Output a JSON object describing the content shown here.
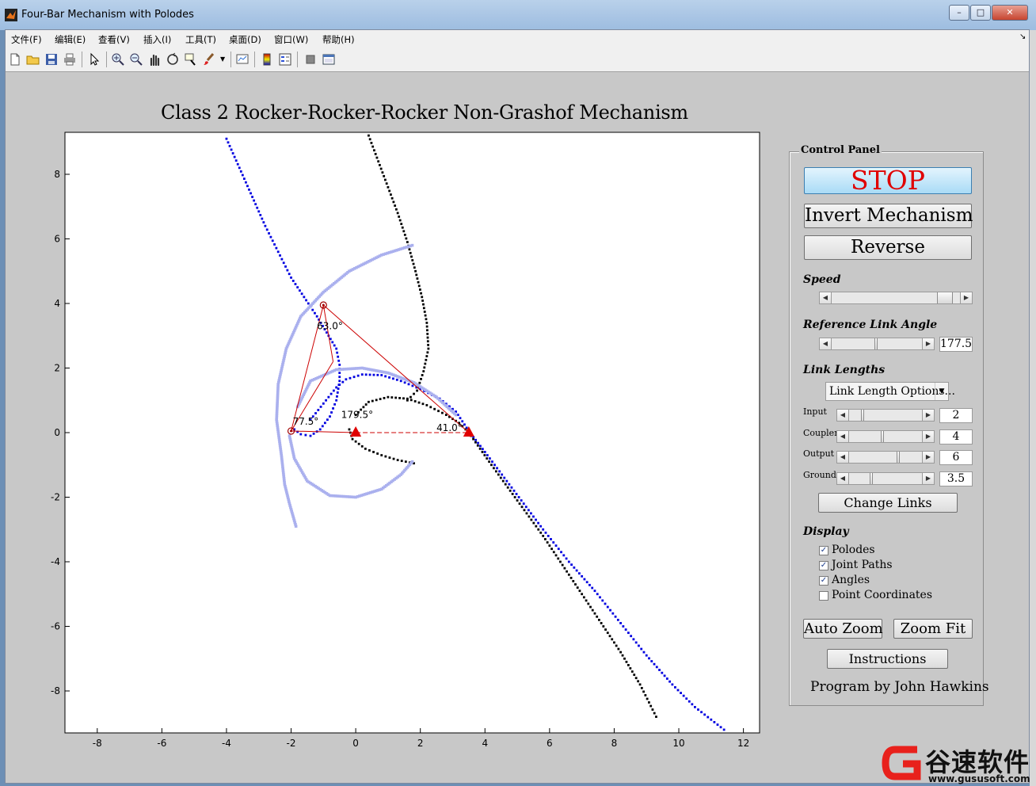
{
  "window": {
    "title": "Four-Bar Mechanism with Polodes",
    "controls": {
      "minimize": "–",
      "maximize": "□",
      "close": "✕"
    }
  },
  "menubar": {
    "items": [
      "文件(F)",
      "编辑(E)",
      "查看(V)",
      "插入(I)",
      "工具(T)",
      "桌面(D)",
      "窗口(W)",
      "帮助(H)"
    ],
    "dock_arrow": "↘"
  },
  "toolbar": {
    "icons": [
      "new-figure-icon",
      "open-file-icon",
      "save-icon",
      "print-icon",
      "pointer-icon",
      "zoom-in-icon",
      "zoom-out-icon",
      "pan-icon",
      "rotate-3d-icon",
      "data-cursor-icon",
      "brush-icon",
      "brush-dropdown-icon",
      "link-plot-icon",
      "colorbar-icon",
      "legend-icon",
      "hide-plot-tools-icon",
      "show-plot-tools-icon"
    ]
  },
  "plot": {
    "title": "Class 2 Rocker-Rocker-Rocker Non-Grashof Mechanism",
    "angle_labels": [
      "63.0°",
      "77.5°",
      "179.5°",
      "41.0°"
    ]
  },
  "chart_data": {
    "type": "scatter",
    "title": "Class 2 Rocker-Rocker-Rocker Non-Grashof Mechanism",
    "xlim": [
      -9,
      12.5
    ],
    "ylim": [
      -9.3,
      9.3
    ],
    "xticks": [
      -8,
      -6,
      -4,
      -2,
      0,
      2,
      4,
      6,
      8,
      10,
      12
    ],
    "yticks": [
      -8,
      -6,
      -4,
      -2,
      0,
      2,
      4,
      6,
      8
    ],
    "grid": false,
    "mechanism": {
      "joints": [
        [
          -2.0,
          0.05
        ],
        [
          -1.0,
          3.95
        ],
        [
          3.5,
          0.0
        ],
        [
          0.0,
          0.0
        ]
      ],
      "fixed_pivots": [
        [
          0.0,
          0.0
        ],
        [
          3.5,
          0.0
        ]
      ],
      "links_color": "#cc0000",
      "pivot_color": "#e00000"
    },
    "series": [
      {
        "color": "#0000e0",
        "points": [
          [
            -4.0,
            9.1
          ],
          [
            -3.6,
            8.2
          ],
          [
            -3.2,
            7.3
          ],
          [
            -2.8,
            6.4
          ],
          [
            -2.4,
            5.6
          ],
          [
            -2.0,
            4.8
          ],
          [
            -1.6,
            4.2
          ],
          [
            -1.2,
            3.6
          ],
          [
            -0.9,
            3.1
          ],
          [
            -0.6,
            2.6
          ],
          [
            -0.5,
            2.1
          ],
          [
            -0.5,
            1.6
          ],
          [
            -0.6,
            1.0
          ],
          [
            -0.8,
            0.5
          ],
          [
            -1.1,
            0.1
          ],
          [
            -1.4,
            -0.1
          ],
          [
            -1.7,
            -0.05
          ],
          [
            -1.9,
            0.1
          ]
        ]
      },
      {
        "color": "#0000e0",
        "points": [
          [
            -1.4,
            0.4
          ],
          [
            -1.0,
            0.9
          ],
          [
            -0.6,
            1.4
          ],
          [
            -0.3,
            1.65
          ],
          [
            0.2,
            1.8
          ],
          [
            0.8,
            1.78
          ],
          [
            1.4,
            1.6
          ],
          [
            2.0,
            1.35
          ],
          [
            2.6,
            1.05
          ],
          [
            3.1,
            0.65
          ],
          [
            3.5,
            0.05
          ],
          [
            4.0,
            -0.6
          ],
          [
            4.6,
            -1.4
          ],
          [
            5.2,
            -2.2
          ],
          [
            5.8,
            -3.0
          ],
          [
            6.6,
            -4.0
          ],
          [
            7.4,
            -4.9
          ],
          [
            8.2,
            -5.9
          ],
          [
            9.0,
            -6.9
          ],
          [
            9.8,
            -7.8
          ],
          [
            10.5,
            -8.5
          ],
          [
            11.4,
            -9.2
          ]
        ]
      },
      {
        "color": "#000000",
        "points": [
          [
            0.4,
            9.2
          ],
          [
            0.7,
            8.4
          ],
          [
            1.0,
            7.6
          ],
          [
            1.3,
            6.8
          ],
          [
            1.6,
            5.9
          ],
          [
            1.85,
            5.0
          ],
          [
            2.05,
            4.2
          ],
          [
            2.2,
            3.4
          ],
          [
            2.25,
            2.6
          ],
          [
            2.1,
            1.9
          ],
          [
            1.9,
            1.3
          ],
          [
            1.6,
            1.0
          ]
        ]
      },
      {
        "color": "#000000",
        "points": [
          [
            0.0,
            0.55
          ],
          [
            0.4,
            0.95
          ],
          [
            1.0,
            1.1
          ],
          [
            1.6,
            1.05
          ],
          [
            2.2,
            0.85
          ],
          [
            2.8,
            0.55
          ],
          [
            3.2,
            0.3
          ],
          [
            3.5,
            0.0
          ],
          [
            4.2,
            -1.0
          ],
          [
            5.0,
            -2.1
          ],
          [
            5.8,
            -3.2
          ],
          [
            6.6,
            -4.4
          ],
          [
            7.4,
            -5.6
          ],
          [
            8.2,
            -6.8
          ],
          [
            8.8,
            -7.8
          ],
          [
            9.3,
            -8.8
          ]
        ]
      },
      {
        "color": "#000000",
        "points": [
          [
            -0.2,
            0.1
          ],
          [
            -0.1,
            -0.2
          ],
          [
            0.3,
            -0.5
          ],
          [
            0.8,
            -0.7
          ],
          [
            1.3,
            -0.85
          ],
          [
            1.8,
            -0.95
          ]
        ]
      },
      {
        "color": "#aab0ee",
        "points": [
          [
            1.75,
            5.8
          ],
          [
            0.8,
            5.5
          ],
          [
            -0.2,
            5.0
          ],
          [
            -1.0,
            4.35
          ],
          [
            -1.7,
            3.6
          ],
          [
            -2.15,
            2.6
          ],
          [
            -2.4,
            1.5
          ],
          [
            -2.45,
            0.4
          ],
          [
            -2.3,
            -0.7
          ],
          [
            -2.2,
            -1.6
          ],
          [
            -2.05,
            -2.2
          ],
          [
            -1.85,
            -2.9
          ]
        ]
      },
      {
        "color": "#aab0ee",
        "points": [
          [
            -1.8,
            0.8
          ],
          [
            -1.4,
            1.6
          ],
          [
            -0.6,
            1.95
          ],
          [
            0.2,
            2.0
          ],
          [
            1.0,
            1.85
          ],
          [
            1.8,
            1.55
          ],
          [
            2.5,
            1.1
          ],
          [
            3.1,
            0.55
          ]
        ]
      },
      {
        "color": "#aab0ee",
        "points": [
          [
            -2.05,
            -0.1
          ],
          [
            -1.9,
            -0.8
          ],
          [
            -1.5,
            -1.5
          ],
          [
            -0.8,
            -1.95
          ],
          [
            0.0,
            -2.0
          ],
          [
            0.8,
            -1.75
          ],
          [
            1.4,
            -1.3
          ],
          [
            1.75,
            -0.9
          ]
        ]
      }
    ]
  },
  "control_panel": {
    "title": "Control Panel",
    "stop_label": "STOP",
    "invert_label": "Invert Mechanism",
    "reverse_label": "Reverse",
    "speed_label": "Speed",
    "speed_fraction": 0.93,
    "ref_angle_label": "Reference Link Angle",
    "ref_angle_value": "177.5",
    "ref_angle_fraction": 0.49,
    "link_lengths_label": "Link Lengths",
    "link_options_value": "Link Length Options...",
    "links": [
      {
        "name": "Input",
        "value": "2",
        "fraction": 0.18
      },
      {
        "name": "Coupler",
        "value": "4",
        "fraction": 0.45
      },
      {
        "name": "Output",
        "value": "6",
        "fraction": 0.68
      },
      {
        "name": "Ground",
        "value": "3.5",
        "fraction": 0.3
      }
    ],
    "change_links_label": "Change Links",
    "display_label": "Display",
    "display_options": [
      {
        "label": "Polodes",
        "checked": true
      },
      {
        "label": "Joint Paths",
        "checked": true
      },
      {
        "label": "Angles",
        "checked": true
      },
      {
        "label": "Point Coordinates",
        "checked": false
      }
    ],
    "auto_zoom_label": "Auto Zoom",
    "zoom_fit_label": "Zoom Fit",
    "instructions_label": "Instructions",
    "credit": "Program by John Hawkins"
  },
  "watermark": {
    "text": "谷速软件",
    "url": "www.gususoft.com"
  }
}
